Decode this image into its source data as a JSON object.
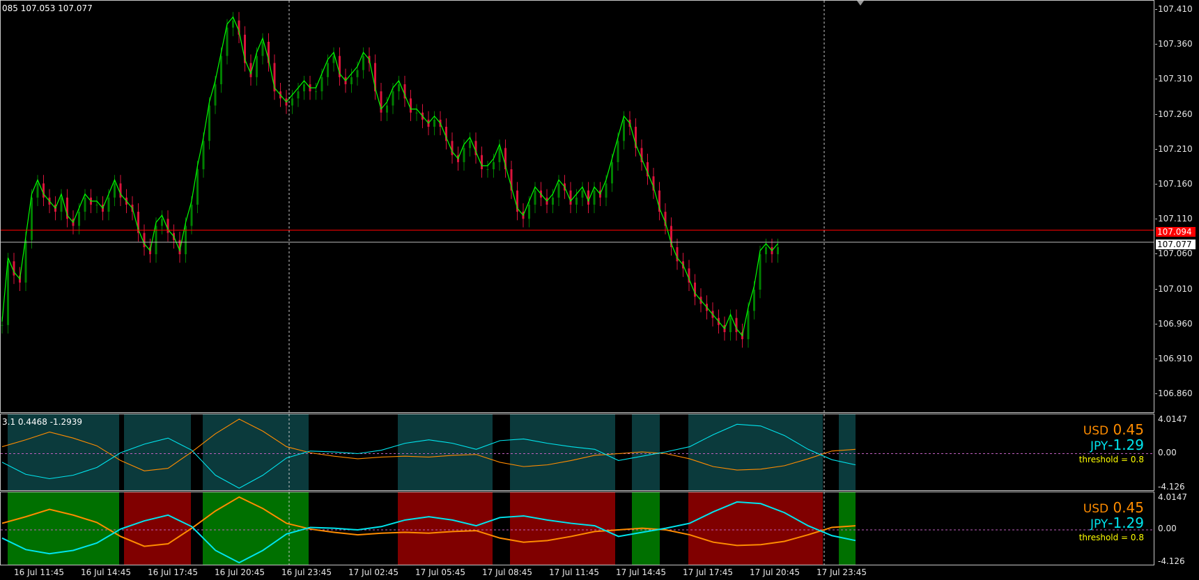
{
  "main_pane": {
    "ohlc_text": "085 107.053 107.077",
    "price_ticks": [
      "107.410",
      "107.360",
      "107.310",
      "107.260",
      "107.210",
      "107.160",
      "107.110",
      "107.060",
      "107.010",
      "106.960",
      "106.910",
      "106.860"
    ],
    "bid_line_label": "107.094",
    "ask_line_label": "107.077",
    "colors": {
      "line": "#00ff00",
      "bull": "#008000",
      "bear": "#dc143c",
      "bid": "#ff0000",
      "ask": "#c0c0c0"
    }
  },
  "indicator1": {
    "header_text": "3.1 0.4468 -1.2939",
    "ticks": [
      "4.0147",
      "0.00",
      "-4.126"
    ],
    "usd_label": "USD",
    "usd_value": "0.45",
    "jpy_label": "JPY",
    "jpy_value": "-1.29",
    "threshold_text": "threshold = 0.8"
  },
  "indicator2": {
    "ticks": [
      "4.0147",
      "0.00",
      "-4.126"
    ],
    "usd_label": "USD",
    "usd_value": "0.45",
    "jpy_label": "JPY",
    "jpy_value": "-1.29",
    "threshold_text": "threshold = 0.8"
  },
  "time_axis": [
    "16 Jul 11:45",
    "16 Jul 14:45",
    "16 Jul 17:45",
    "16 Jul 20:45",
    "16 Jul 23:45",
    "17 Jul 02:45",
    "17 Jul 05:45",
    "17 Jul 08:45",
    "17 Jul 11:45",
    "17 Jul 14:45",
    "17 Jul 17:45",
    "17 Jul 20:45",
    "17 Jul 23:45"
  ],
  "colors": {
    "usd": "#ff8c00",
    "jpy": "#00e5ee",
    "threshold": "#ffff00",
    "zone_teal": "#0b3a3c",
    "zone_green": "#007000",
    "zone_red": "#800000"
  }
}
